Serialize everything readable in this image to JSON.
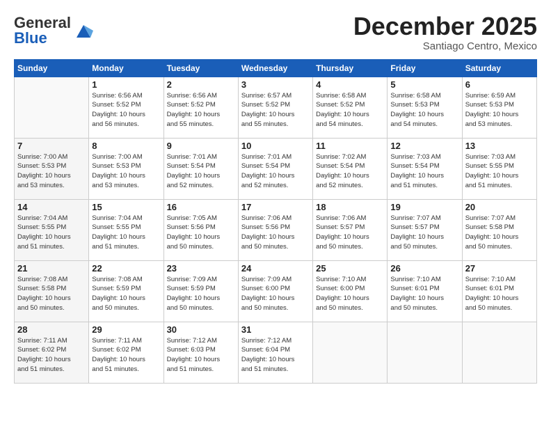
{
  "header": {
    "logo_general": "General",
    "logo_blue": "Blue",
    "month_title": "December 2025",
    "subtitle": "Santiago Centro, Mexico"
  },
  "days_of_week": [
    "Sunday",
    "Monday",
    "Tuesday",
    "Wednesday",
    "Thursday",
    "Friday",
    "Saturday"
  ],
  "weeks": [
    [
      {
        "day": "",
        "info": ""
      },
      {
        "day": "1",
        "info": "Sunrise: 6:56 AM\nSunset: 5:52 PM\nDaylight: 10 hours\nand 56 minutes."
      },
      {
        "day": "2",
        "info": "Sunrise: 6:56 AM\nSunset: 5:52 PM\nDaylight: 10 hours\nand 55 minutes."
      },
      {
        "day": "3",
        "info": "Sunrise: 6:57 AM\nSunset: 5:52 PM\nDaylight: 10 hours\nand 55 minutes."
      },
      {
        "day": "4",
        "info": "Sunrise: 6:58 AM\nSunset: 5:52 PM\nDaylight: 10 hours\nand 54 minutes."
      },
      {
        "day": "5",
        "info": "Sunrise: 6:58 AM\nSunset: 5:53 PM\nDaylight: 10 hours\nand 54 minutes."
      },
      {
        "day": "6",
        "info": "Sunrise: 6:59 AM\nSunset: 5:53 PM\nDaylight: 10 hours\nand 53 minutes."
      }
    ],
    [
      {
        "day": "7",
        "info": "Sunrise: 7:00 AM\nSunset: 5:53 PM\nDaylight: 10 hours\nand 53 minutes."
      },
      {
        "day": "8",
        "info": "Sunrise: 7:00 AM\nSunset: 5:53 PM\nDaylight: 10 hours\nand 53 minutes."
      },
      {
        "day": "9",
        "info": "Sunrise: 7:01 AM\nSunset: 5:54 PM\nDaylight: 10 hours\nand 52 minutes."
      },
      {
        "day": "10",
        "info": "Sunrise: 7:01 AM\nSunset: 5:54 PM\nDaylight: 10 hours\nand 52 minutes."
      },
      {
        "day": "11",
        "info": "Sunrise: 7:02 AM\nSunset: 5:54 PM\nDaylight: 10 hours\nand 52 minutes."
      },
      {
        "day": "12",
        "info": "Sunrise: 7:03 AM\nSunset: 5:54 PM\nDaylight: 10 hours\nand 51 minutes."
      },
      {
        "day": "13",
        "info": "Sunrise: 7:03 AM\nSunset: 5:55 PM\nDaylight: 10 hours\nand 51 minutes."
      }
    ],
    [
      {
        "day": "14",
        "info": "Sunrise: 7:04 AM\nSunset: 5:55 PM\nDaylight: 10 hours\nand 51 minutes."
      },
      {
        "day": "15",
        "info": "Sunrise: 7:04 AM\nSunset: 5:55 PM\nDaylight: 10 hours\nand 51 minutes."
      },
      {
        "day": "16",
        "info": "Sunrise: 7:05 AM\nSunset: 5:56 PM\nDaylight: 10 hours\nand 50 minutes."
      },
      {
        "day": "17",
        "info": "Sunrise: 7:06 AM\nSunset: 5:56 PM\nDaylight: 10 hours\nand 50 minutes."
      },
      {
        "day": "18",
        "info": "Sunrise: 7:06 AM\nSunset: 5:57 PM\nDaylight: 10 hours\nand 50 minutes."
      },
      {
        "day": "19",
        "info": "Sunrise: 7:07 AM\nSunset: 5:57 PM\nDaylight: 10 hours\nand 50 minutes."
      },
      {
        "day": "20",
        "info": "Sunrise: 7:07 AM\nSunset: 5:58 PM\nDaylight: 10 hours\nand 50 minutes."
      }
    ],
    [
      {
        "day": "21",
        "info": "Sunrise: 7:08 AM\nSunset: 5:58 PM\nDaylight: 10 hours\nand 50 minutes."
      },
      {
        "day": "22",
        "info": "Sunrise: 7:08 AM\nSunset: 5:59 PM\nDaylight: 10 hours\nand 50 minutes."
      },
      {
        "day": "23",
        "info": "Sunrise: 7:09 AM\nSunset: 5:59 PM\nDaylight: 10 hours\nand 50 minutes."
      },
      {
        "day": "24",
        "info": "Sunrise: 7:09 AM\nSunset: 6:00 PM\nDaylight: 10 hours\nand 50 minutes."
      },
      {
        "day": "25",
        "info": "Sunrise: 7:10 AM\nSunset: 6:00 PM\nDaylight: 10 hours\nand 50 minutes."
      },
      {
        "day": "26",
        "info": "Sunrise: 7:10 AM\nSunset: 6:01 PM\nDaylight: 10 hours\nand 50 minutes."
      },
      {
        "day": "27",
        "info": "Sunrise: 7:10 AM\nSunset: 6:01 PM\nDaylight: 10 hours\nand 50 minutes."
      }
    ],
    [
      {
        "day": "28",
        "info": "Sunrise: 7:11 AM\nSunset: 6:02 PM\nDaylight: 10 hours\nand 51 minutes."
      },
      {
        "day": "29",
        "info": "Sunrise: 7:11 AM\nSunset: 6:02 PM\nDaylight: 10 hours\nand 51 minutes."
      },
      {
        "day": "30",
        "info": "Sunrise: 7:12 AM\nSunset: 6:03 PM\nDaylight: 10 hours\nand 51 minutes."
      },
      {
        "day": "31",
        "info": "Sunrise: 7:12 AM\nSunset: 6:04 PM\nDaylight: 10 hours\nand 51 minutes."
      },
      {
        "day": "",
        "info": ""
      },
      {
        "day": "",
        "info": ""
      },
      {
        "day": "",
        "info": ""
      }
    ]
  ]
}
